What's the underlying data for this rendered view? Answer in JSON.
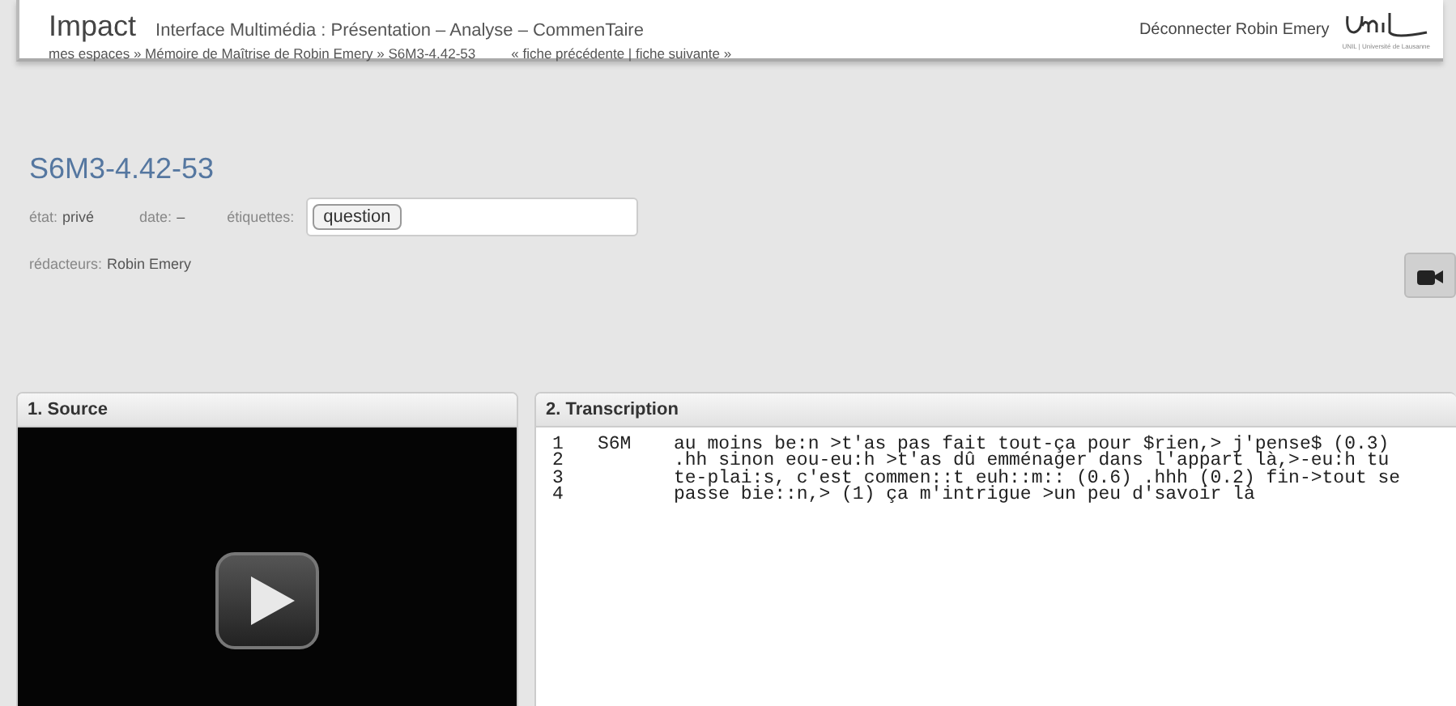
{
  "header": {
    "app_name": "Impact",
    "subtitle": "Interface Multimédia : Présentation – Analyse – CommenTaire",
    "breadcrumb": "mes espaces » Mémoire de Maîtrise de Robin Emery » S6M3-4.42-53",
    "nav": "« fiche précédente | fiche suivante »",
    "logout": "Déconnecter Robin Emery",
    "logo_sub": "UNIL | Université de Lausanne"
  },
  "record": {
    "title": "S6M3-4.42-53",
    "state_label": "état:",
    "state": "privé",
    "date_label": "date:",
    "date": "–",
    "tags_label": "étiquettes:",
    "tags": [
      "question"
    ],
    "editors_label": "rédacteurs:",
    "editors": "Robin Emery"
  },
  "source": {
    "title": "1. Source",
    "kind": "video"
  },
  "transcription": {
    "title": "2. Transcription",
    "lines": [
      {
        "number": "1",
        "speaker": "S6M",
        "text": "au moins be:n >t'as pas fait tout-ça pour $rien,> j'pense$ (0.3)"
      },
      {
        "number": "2",
        "text": ".hh sinon eou-eu:h >t'as dû emménager dans l'appart là,>-eu:h tu"
      },
      {
        "number": "3",
        "text": "te-plai:s, c'est commen::t euh::m:: (0.6) .hhh (0.2) fin->tout se"
      },
      {
        "number": "4",
        "text": "passe bie::n,> (1) ça m'intrigue >un peu d'savoir là"
      }
    ]
  }
}
